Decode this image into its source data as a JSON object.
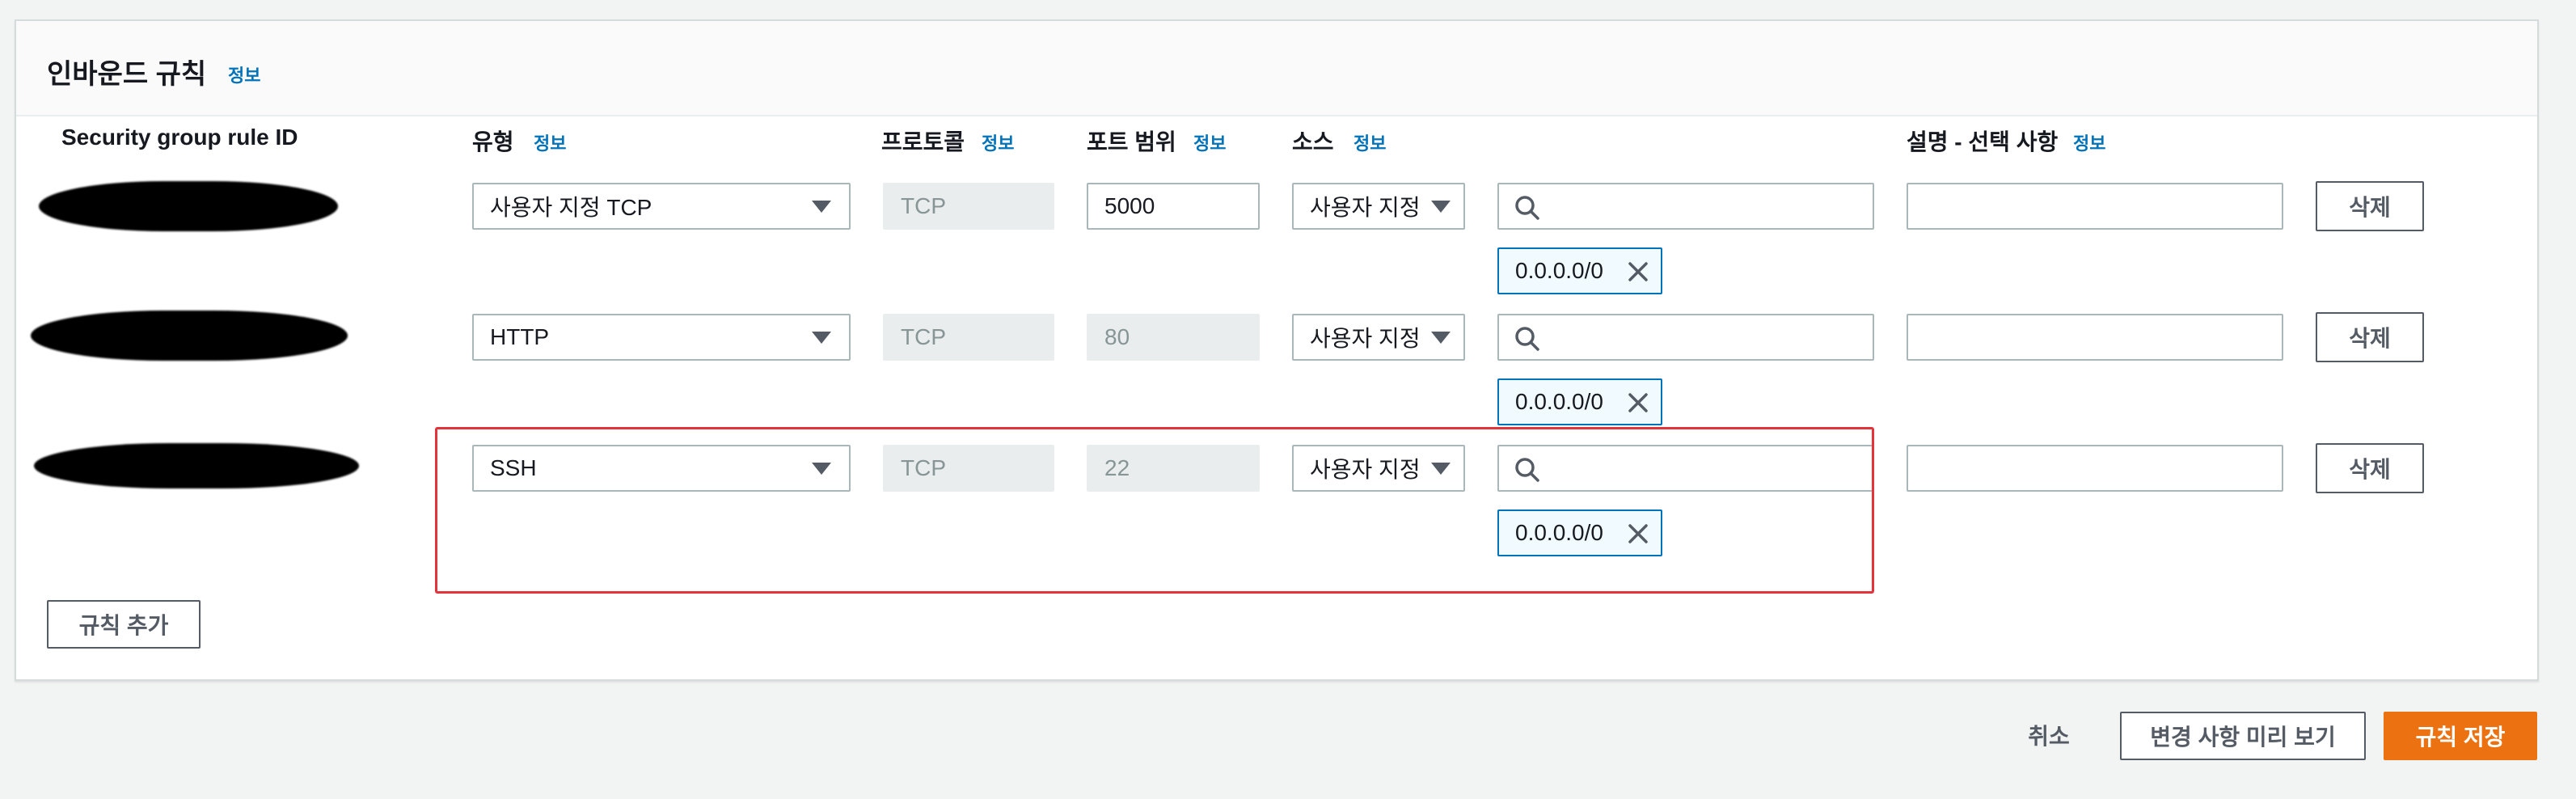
{
  "panel": {
    "title": "인바운드 규칙",
    "title_info": "정보"
  },
  "columns": {
    "rule_id": "Security group rule ID",
    "type": "유형",
    "type_info": "정보",
    "protocol": "프로토콜",
    "protocol_info": "정보",
    "port_range": "포트 범위",
    "port_range_info": "정보",
    "source": "소스",
    "source_info": "정보",
    "description": "설명 - 선택 사항",
    "description_info": "정보"
  },
  "rules": [
    {
      "type": "사용자 지정 TCP",
      "protocol": "TCP",
      "port_range": "5000",
      "source_type": "사용자 지정",
      "source_search": "",
      "source_token": "0.0.0.0/0",
      "description": "",
      "delete_label": "삭제"
    },
    {
      "type": "HTTP",
      "protocol": "TCP",
      "port_range": "80",
      "source_type": "사용자 지정",
      "source_search": "",
      "source_token": "0.0.0.0/0",
      "description": "",
      "delete_label": "삭제"
    },
    {
      "type": "SSH",
      "protocol": "TCP",
      "port_range": "22",
      "source_type": "사용자 지정",
      "source_search": "",
      "source_token": "0.0.0.0/0",
      "description": "",
      "delete_label": "삭제"
    }
  ],
  "add_rule_label": "규칙 추가",
  "footer": {
    "cancel_label": "취소",
    "preview_label": "변경 사항 미리 보기",
    "save_label": "규칙 저장"
  },
  "icons": {
    "search": "search-icon",
    "token_remove": "close-icon",
    "dropdown": "caret-down-icon"
  },
  "colors": {
    "primary_button": "#ec7211",
    "info_link": "#0073bb",
    "token_border": "#0073bb",
    "highlight_box": "#e3343c"
  }
}
